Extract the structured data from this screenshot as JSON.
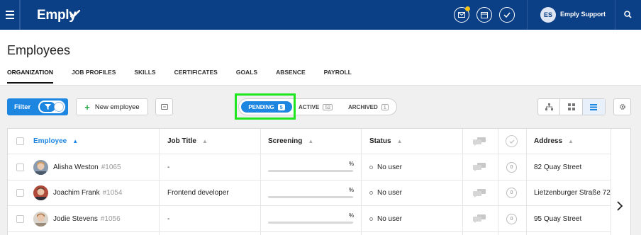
{
  "app": {
    "name": "Emply"
  },
  "topbar": {
    "user_initials": "ES",
    "user_name": "Emply Support",
    "icons": [
      "menu-icon",
      "mail-icon",
      "calendar-icon",
      "check-icon",
      "search-icon"
    ],
    "notification_color": "#f5c518"
  },
  "page": {
    "title": "Employees",
    "tabs": [
      {
        "label": "ORGANIZATION",
        "active": true
      },
      {
        "label": "JOB PROFILES"
      },
      {
        "label": "SKILLS"
      },
      {
        "label": "CERTIFICATES"
      },
      {
        "label": "GOALS"
      },
      {
        "label": "ABSENCE"
      },
      {
        "label": "PAYROLL"
      }
    ]
  },
  "toolbar": {
    "filter_label": "Filter",
    "new_employee_label": "New employee",
    "status": {
      "pending_label": "PENDING",
      "pending_count": "5",
      "active_label": "ACTIVE",
      "active_count": "52",
      "archived_label": "ARCHIVED",
      "archived_count": "1"
    }
  },
  "table": {
    "columns": {
      "employee": "Employee",
      "job_title": "Job Title",
      "screening": "Screening",
      "status": "Status",
      "address": "Address"
    },
    "rows": [
      {
        "name": "Alisha Weston",
        "id": "#1065",
        "job_title": "-",
        "screening_pct": "%",
        "status": "No user",
        "comments": "0",
        "address": "82 Quay Street"
      },
      {
        "name": "Joachim Frank",
        "id": "#1054",
        "job_title": "Frontend developer",
        "screening_pct": "%",
        "status": "No user",
        "comments": "0",
        "address": "Lietzenburger Straße 72"
      },
      {
        "name": "Jodie Stevens",
        "id": "#1056",
        "job_title": "-",
        "screening_pct": "%",
        "status": "No user",
        "comments": "0",
        "address": "95 Quay Street"
      }
    ]
  },
  "colors": {
    "brand_navy": "#0b3f86",
    "accent_blue": "#1d86e0",
    "highlight_green": "#1ee51e",
    "add_green": "#2aa84a"
  }
}
